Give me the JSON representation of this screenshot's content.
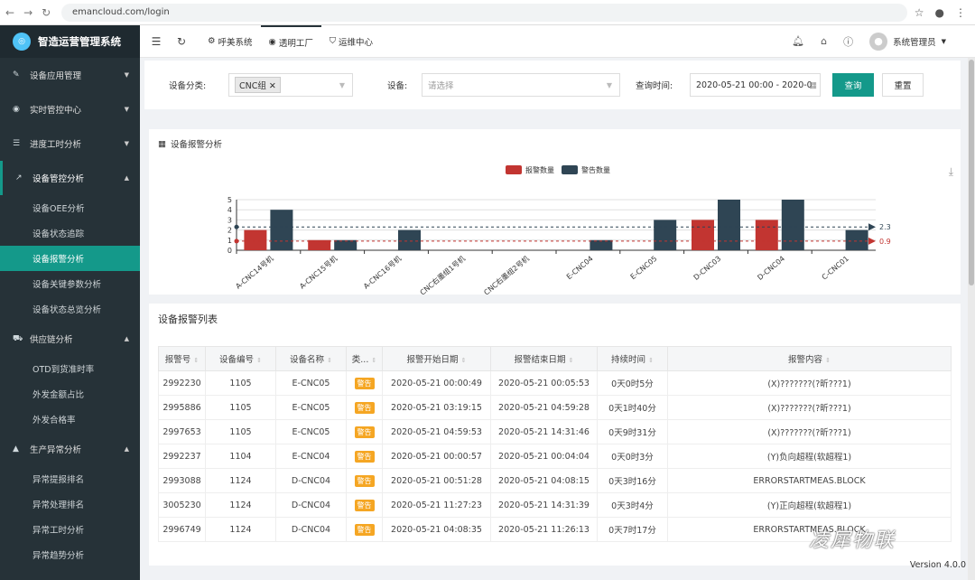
{
  "browser": {
    "url": "emancloud.com/login"
  },
  "sidebar": {
    "app_title": "智造运营管理系统",
    "groups": [
      {
        "label": "设备应用管理",
        "icon": "wrench-icon"
      },
      {
        "label": "实时管控中心",
        "icon": "target-icon"
      },
      {
        "label": "进度工时分析",
        "icon": "list-icon"
      },
      {
        "label": "设备管控分析",
        "icon": "chart-line-icon"
      },
      {
        "label": "供应链分析",
        "icon": "truck-icon"
      },
      {
        "label": "生产异常分析",
        "icon": "warning-icon"
      }
    ],
    "sub_device": [
      "设备OEE分析",
      "设备状态追踪",
      "设备报警分析",
      "设备关键参数分析",
      "设备状态总览分析"
    ],
    "sub_supply": [
      "OTD到货准时率",
      "外发金额占比",
      "外发合格率"
    ],
    "sub_exception": [
      "异常提报排名",
      "异常处理排名",
      "异常工时分析",
      "异常趋势分析"
    ]
  },
  "topbar": {
    "nav": [
      {
        "label": "呼美系统",
        "icon": "gear-icon"
      },
      {
        "label": "透明工厂",
        "icon": "pin-icon"
      },
      {
        "label": "运维中心",
        "icon": "shield-icon"
      }
    ],
    "user": "系统管理员"
  },
  "filter": {
    "category_label": "设备分类:",
    "category_tag": "CNC组",
    "device_label": "设备:",
    "device_placeholder": "请选择",
    "time_label": "查询时间:",
    "time_value": "2020-05-21 00:00 - 2020-0",
    "query": "查询",
    "reset": "重置"
  },
  "chart_panel": {
    "title": "设备报警分析"
  },
  "chart_data": {
    "type": "bar",
    "categories": [
      "A-CNC14号机",
      "A-CNC15号机",
      "A-CNC16号机",
      "CNC右墨组1号机",
      "CNC右墨组2号机",
      "E-CNC04",
      "E-CNC05",
      "D-CNC03",
      "D-CNC04",
      "C-CNC01"
    ],
    "series": [
      {
        "name": "报警数量",
        "color": "#c23531",
        "values": [
          2,
          1,
          0,
          0,
          0,
          0,
          0,
          3,
          3,
          0
        ]
      },
      {
        "name": "警告数量",
        "color": "#2f4554",
        "values": [
          4,
          1,
          2,
          0,
          0,
          1,
          3,
          5,
          5,
          2
        ]
      }
    ],
    "ylim": [
      0,
      5
    ],
    "yticks": [
      "0",
      "1",
      "2",
      "3",
      "4",
      "5"
    ],
    "mark_lines": [
      {
        "value": 2.3,
        "label": "2.3",
        "color": "#2f4554"
      },
      {
        "value": 0.9,
        "label": "0.9",
        "color": "#c23531"
      }
    ],
    "legend": "top-center"
  },
  "list": {
    "title": "设备报警列表",
    "headers": [
      "报警号",
      "设备编号",
      "设备名称",
      "类...",
      "报警开始日期",
      "报警结束日期",
      "持续时间",
      "报警内容"
    ],
    "rows": [
      [
        "2992230",
        "1105",
        "E-CNC05",
        "警告",
        "2020-05-21 00:00:49",
        "2020-05-21 00:05:53",
        "0天0时5分",
        "(X)???????(?昕???1)"
      ],
      [
        "2995886",
        "1105",
        "E-CNC05",
        "警告",
        "2020-05-21 03:19:15",
        "2020-05-21 04:59:28",
        "0天1时40分",
        "(X)???????(?昕???1)"
      ],
      [
        "2997653",
        "1105",
        "E-CNC05",
        "警告",
        "2020-05-21 04:59:53",
        "2020-05-21 14:31:46",
        "0天9时31分",
        "(X)???????(?昕???1)"
      ],
      [
        "2992237",
        "1104",
        "E-CNC04",
        "警告",
        "2020-05-21 00:00:57",
        "2020-05-21 00:04:04",
        "0天0时3分",
        "(Y)负向超程(软超程1)"
      ],
      [
        "2993088",
        "1124",
        "D-CNC04",
        "警告",
        "2020-05-21 00:51:28",
        "2020-05-21 04:08:15",
        "0天3时16分",
        "ERRORSTARTMEAS.BLOCK"
      ],
      [
        "3005230",
        "1124",
        "D-CNC04",
        "警告",
        "2020-05-21 11:27:23",
        "2020-05-21 14:31:39",
        "0天3时4分",
        "(Y)正向超程(软超程1)"
      ],
      [
        "2996749",
        "1124",
        "D-CNC04",
        "警告",
        "2020-05-21 04:08:35",
        "2020-05-21 11:26:13",
        "0天7时17分",
        "ERRORSTARTMEAS.BLOCK"
      ]
    ]
  },
  "footer": {
    "version": "Version 4.0.0",
    "watermark": "凌犀物联"
  }
}
